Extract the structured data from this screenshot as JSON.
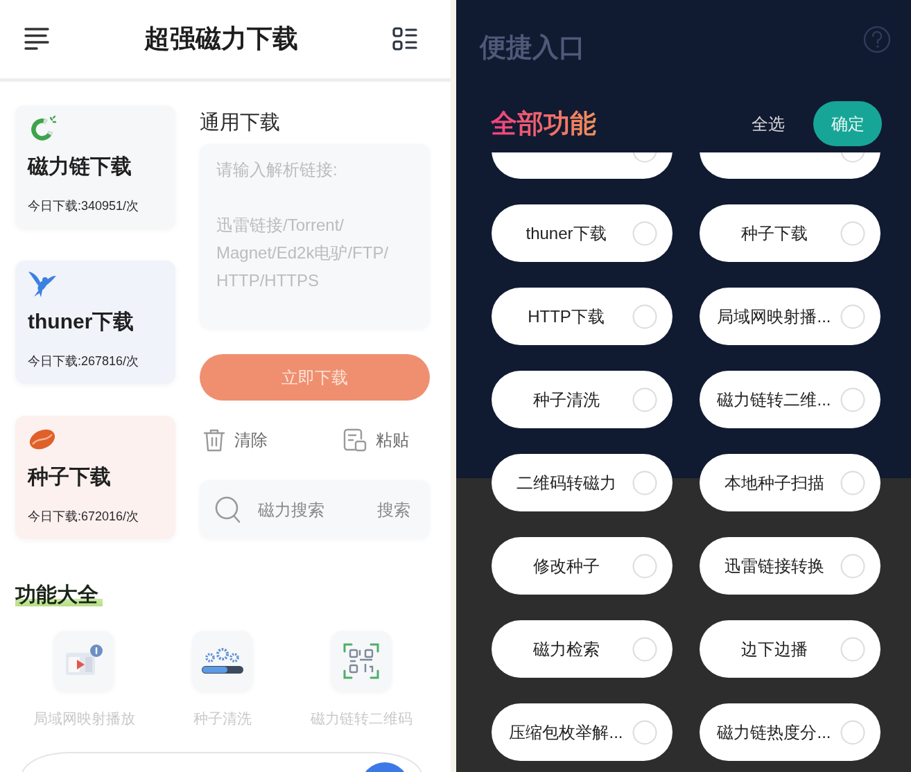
{
  "left_screen": {
    "header": {
      "title": "超强磁力下载"
    },
    "download_cards": [
      {
        "kind": "magnet",
        "title": "磁力链下载",
        "count": "今日下载:340951/次"
      },
      {
        "kind": "thunder",
        "title": "thuner下载",
        "count": "今日下载:267816/次"
      },
      {
        "kind": "seed",
        "title": "种子下载",
        "count": "今日下载:672016/次"
      }
    ],
    "general_download": {
      "heading": "通用下载",
      "link_input": {
        "placeholder": "请输入解析链接:\n\n迅雷链接/Torrent/\nMagnet/Ed2k电驴/FTP/\nHTTP/HTTPS"
      },
      "download_button": "立即下载",
      "clear_button": "清除",
      "paste_button": "粘贴",
      "search": {
        "placeholder": "磁力搜索",
        "button": "搜索"
      }
    },
    "features": {
      "heading": "功能大全",
      "items": [
        {
          "kind": "lan_cast",
          "label": "局域网映射播放"
        },
        {
          "kind": "seed_clean",
          "label": "种子清洗"
        },
        {
          "kind": "qr_code",
          "label": "磁力链转二维码"
        }
      ]
    }
  },
  "right_screen": {
    "background_title": "便捷入口",
    "panel": {
      "title": "全部功能",
      "select_all": "全选",
      "confirm_button": "确定",
      "options": [
        {
          "selected": false
        },
        {
          "selected": false
        },
        {
          "label": "thuner下载",
          "selected": false
        },
        {
          "label": "种子下载",
          "selected": false
        },
        {
          "label": "HTTP下载",
          "selected": false
        },
        {
          "label": "局域网映射播...",
          "selected": false
        },
        {
          "label": "种子清洗",
          "selected": false
        },
        {
          "label": "磁力链转二维...",
          "selected": false
        },
        {
          "label": "二维码转磁力",
          "selected": false
        },
        {
          "label": "本地种子扫描",
          "selected": false
        },
        {
          "label": "修改种子",
          "selected": false
        },
        {
          "label": "迅雷链接转换",
          "selected": false
        },
        {
          "label": "磁力检索",
          "selected": false
        },
        {
          "label": "边下边播",
          "selected": false
        },
        {
          "label": "压缩包枚举解...",
          "selected": false
        },
        {
          "label": "磁力链热度分...",
          "selected": false
        }
      ]
    }
  }
}
